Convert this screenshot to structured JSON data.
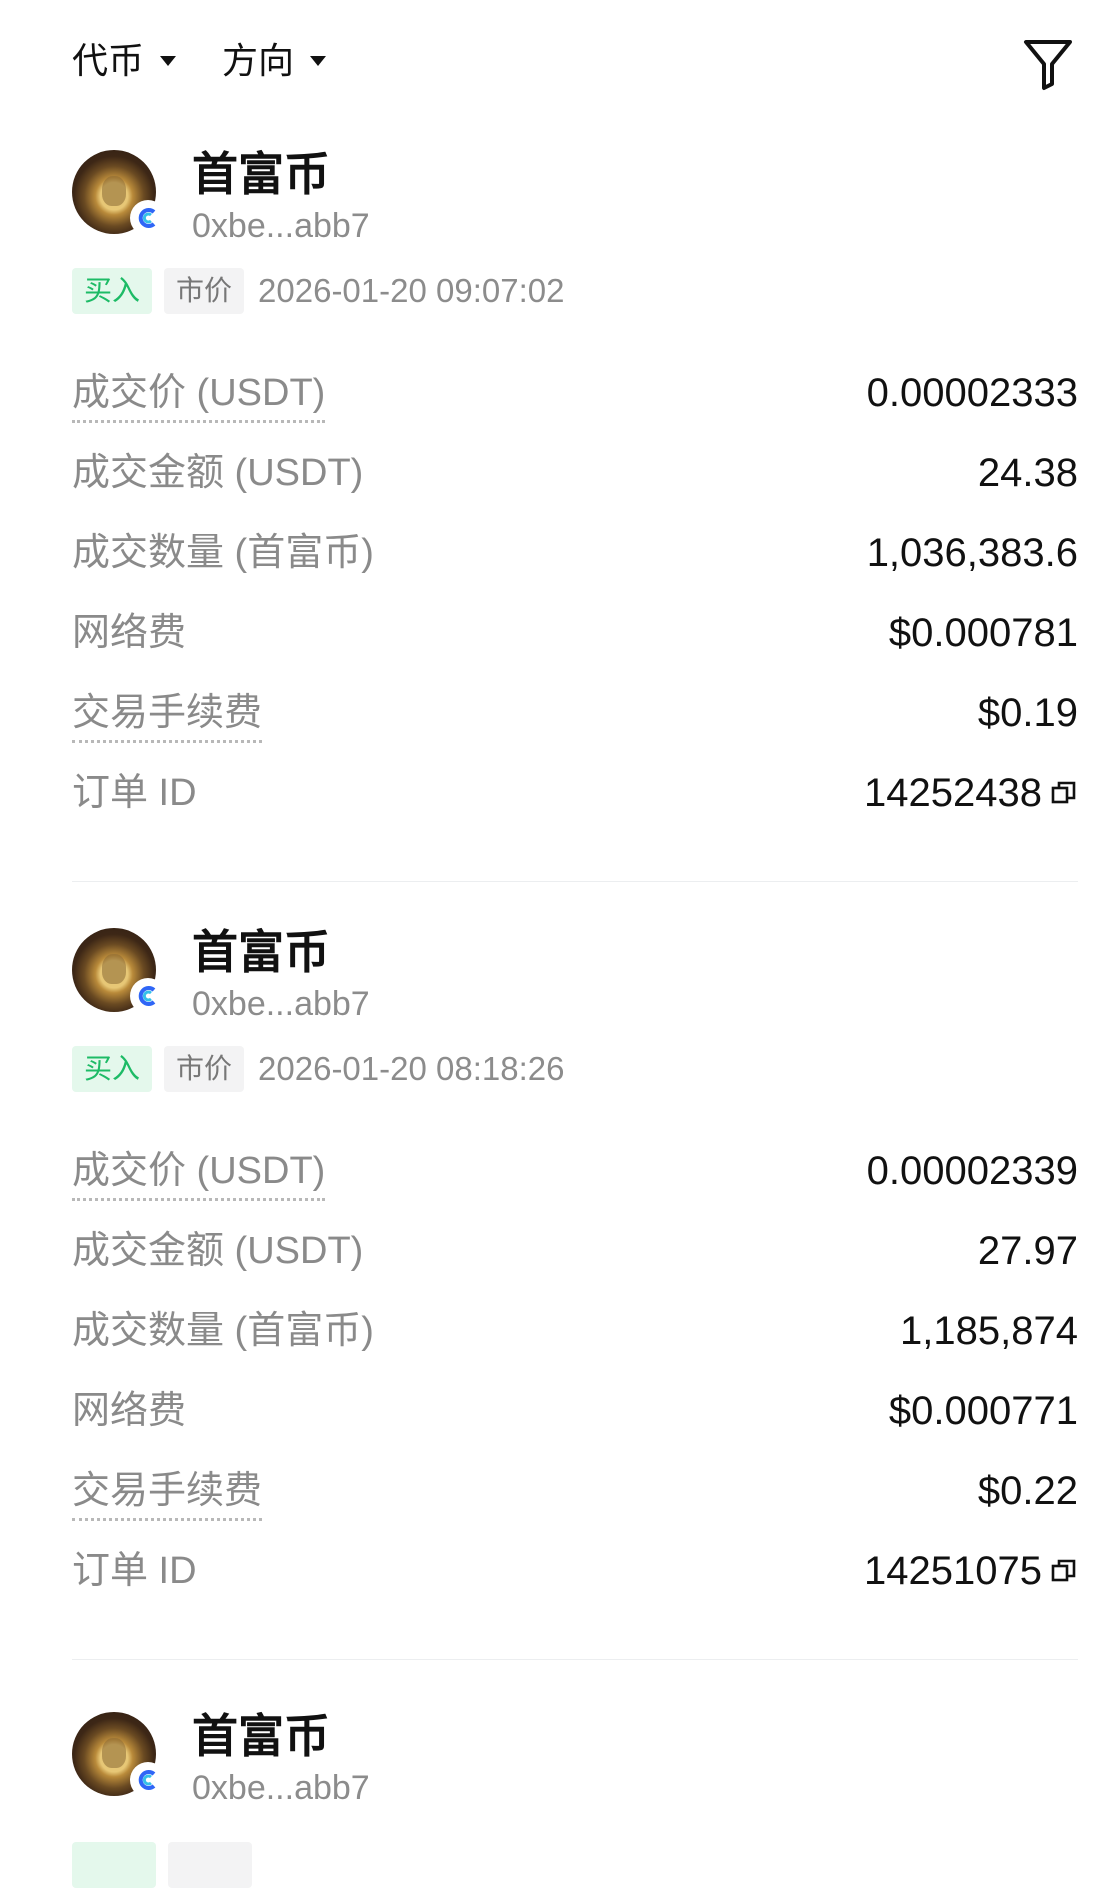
{
  "header": {
    "token_filter_label": "代币",
    "side_filter_label": "方向",
    "filter_icon": "funnel-icon"
  },
  "labels": {
    "price": "成交价 (USDT)",
    "amount": "成交金额 (USDT)",
    "quantity": "成交数量 (首富币)",
    "network_fee": "网络费",
    "trade_fee": "交易手续费",
    "order_id": "订单 ID"
  },
  "colors": {
    "buy_text": "#1dbb66",
    "buy_bg": "#e4f8ec",
    "muted": "#8a8a8a",
    "divider": "#eceef0"
  },
  "orders": [
    {
      "token_name": "首富币",
      "address": "0xbe...abb7",
      "side": "买入",
      "order_type": "市价",
      "time": "2026-01-20 09:07:02",
      "price": "0.00002333",
      "amount": "24.38",
      "quantity": "1,036,383.6",
      "network_fee": "$0.000781",
      "trade_fee": "$0.19",
      "order_id": "14252438"
    },
    {
      "token_name": "首富币",
      "address": "0xbe...abb7",
      "side": "买入",
      "order_type": "市价",
      "time": "2026-01-20 08:18:26",
      "price": "0.00002339",
      "amount": "27.97",
      "quantity": "1,185,874",
      "network_fee": "$0.000771",
      "trade_fee": "$0.22",
      "order_id": "14251075"
    },
    {
      "token_name": "首富币",
      "address": "0xbe...abb7"
    }
  ]
}
